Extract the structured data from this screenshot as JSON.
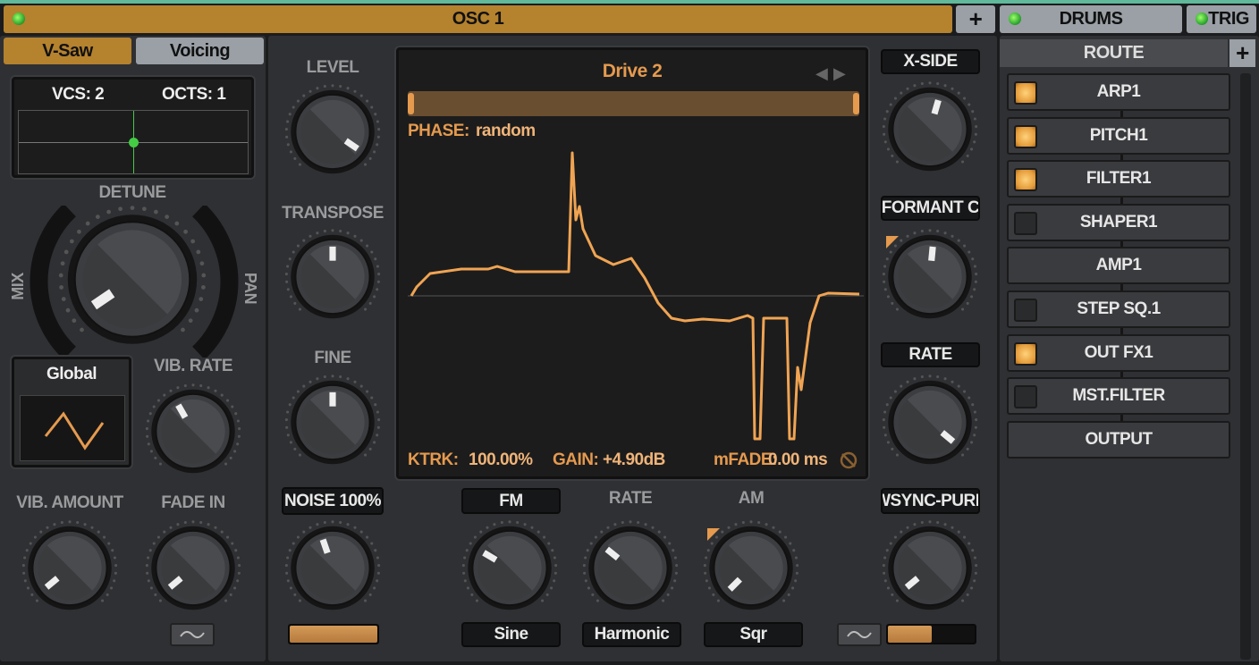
{
  "header": {
    "title": "OSC 1",
    "add_label": "+",
    "drums_label": "DRUMS",
    "trig_label": "TRIG"
  },
  "tabs": {
    "vsaw": "V-Saw",
    "voicing": "Voicing"
  },
  "voicing": {
    "vcs": "VCS: 2",
    "octs": "OCTS: 1"
  },
  "labels": {
    "detune": "DETUNE",
    "mix": "MIX",
    "pan": "PAN",
    "vib_rate": "VIB. RATE",
    "vib_amount": "VIB. AMOUNT",
    "fade_in": "FADE IN",
    "level": "LEVEL",
    "transpose": "TRANSPOSE",
    "fine": "FINE",
    "rate": "RATE",
    "am": "AM"
  },
  "lfo": {
    "mode": "Global"
  },
  "boxes": {
    "noise": "NOISE 100%",
    "x_side": "X-SIDE",
    "formant": "FORMANT C",
    "rate": "RATE",
    "wsync": "WSYNC-PURE",
    "fm": "FM",
    "fm_shape": "Sine",
    "rate_mode": "Harmonic",
    "am_shape": "Sqr"
  },
  "display": {
    "title": "Drive 2",
    "phase_label": "PHASE:",
    "phase_value": "random",
    "ktrk_label": "KTRK:",
    "ktrk_value": "100.00%",
    "gain_label": "GAIN:",
    "gain_value": "+4.90dB",
    "mfade_label": "mFADE:",
    "mfade_value": "0.00 ms"
  },
  "knobs": {
    "detune": {
      "value": 0.04
    },
    "vib_rate": {
      "value": 0.39
    },
    "vib_amount": {
      "value": 0.02
    },
    "fade_in": {
      "value": 0.02
    },
    "level": {
      "value": 0.96
    },
    "transpose": {
      "value": 0.5
    },
    "fine": {
      "value": 0.5
    },
    "noise": {
      "value": 0.43
    },
    "x_side": {
      "value": 0.56
    },
    "formant": {
      "value": 0.52
    },
    "rate_r": {
      "value": 0.98
    },
    "wsync": {
      "value": 0.02
    },
    "fm": {
      "value": 0.28
    },
    "rate_m": {
      "value": 0.31
    },
    "am": {
      "value": 0.0
    }
  },
  "bars": {
    "noise_level": 1.0,
    "wsync_level": 0.5
  },
  "route": {
    "title": "ROUTE",
    "add_label": "+",
    "items": [
      {
        "label": "ARP1",
        "state": "on"
      },
      {
        "label": "PITCH1",
        "state": "on"
      },
      {
        "label": "FILTER1",
        "state": "on"
      },
      {
        "label": "SHAPER1",
        "state": "off"
      },
      {
        "label": "AMP1",
        "state": "none"
      },
      {
        "label": "STEP SQ.1",
        "state": "off"
      },
      {
        "label": "OUT FX1",
        "state": "on"
      },
      {
        "label": "MST.FILTER",
        "state": "off"
      },
      {
        "label": "OUTPUT",
        "state": "none"
      }
    ]
  },
  "colors": {
    "accent": "#b5822e",
    "waveform": "#f0a452",
    "led": "#44cc33"
  }
}
